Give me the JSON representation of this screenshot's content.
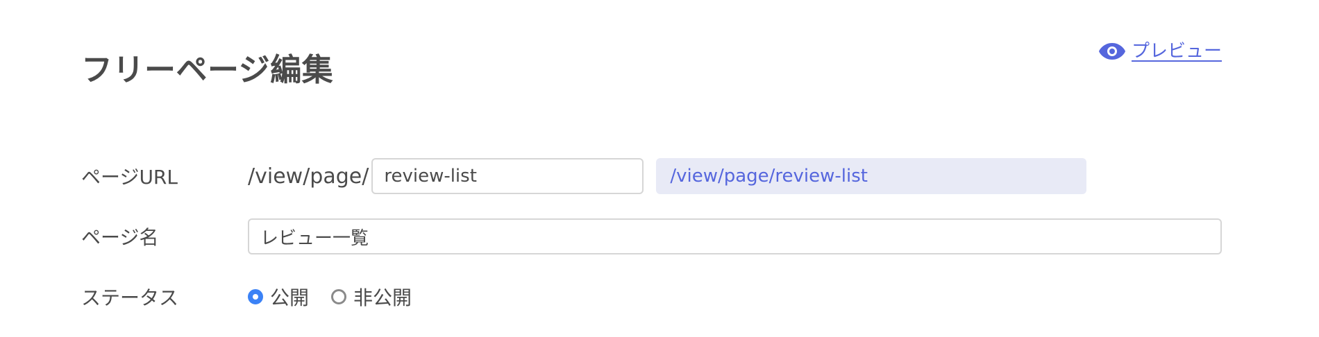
{
  "header": {
    "title": "フリーページ編集",
    "preview_label": "プレビュー"
  },
  "form": {
    "url": {
      "label": "ページURL",
      "prefix": "/view/page/",
      "slug_value": "review-list",
      "full_url": "/view/page/review-list"
    },
    "name": {
      "label": "ページ名",
      "value": "レビュー一覧"
    },
    "status": {
      "label": "ステータス",
      "options": [
        {
          "label": "公開",
          "checked": true
        },
        {
          "label": "非公開",
          "checked": false
        }
      ]
    }
  },
  "colors": {
    "accent": "#5566dd",
    "radio_checked": "#3b82f6",
    "url_preview_bg": "#e8eaf6",
    "text": "#4a4a4a"
  },
  "icons": {
    "preview": "eye-icon"
  }
}
